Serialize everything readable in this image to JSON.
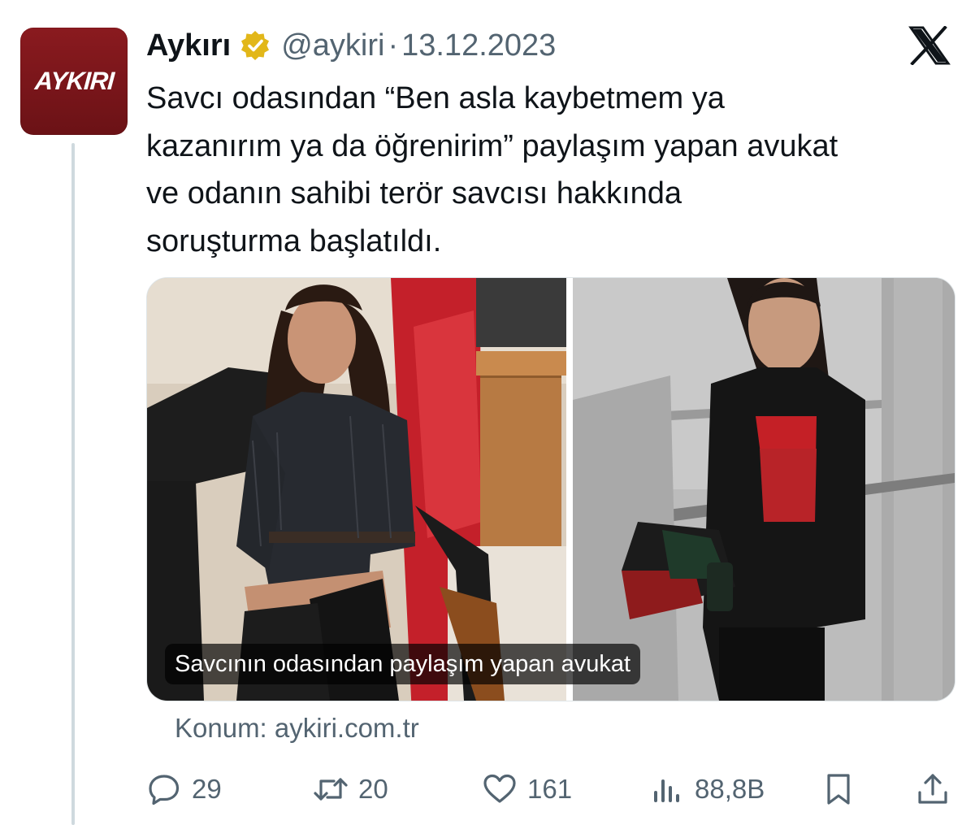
{
  "author": {
    "avatar_logo_text": "AYKIRI",
    "display_name": "Aykırı",
    "verified_icon": "gold-verified-badge-icon",
    "handle": "@aykiri",
    "separator": "·",
    "date": "13.12.2023"
  },
  "platform_icon": "x-logo-icon",
  "tweet": {
    "lines": [
      "Savcı odasından “Ben asla kaybetmem ya",
      "kazanırım ya da öğrenirim” paylaşım yapan avukat",
      "ve odanın sahibi terör savcısı hakkında",
      "soruşturma başlatıldı."
    ]
  },
  "media": {
    "left_photo": "photo-woman-seated-in-office-chair",
    "right_photo": "photo-woman-standing-in-courthouse",
    "caption": "Savcının odasından paylaşım yapan avukat"
  },
  "location": "Konum: aykiri.com.tr",
  "actions": {
    "reply": {
      "icon": "reply-icon",
      "count": "29"
    },
    "retweet": {
      "icon": "retweet-icon",
      "count": "20"
    },
    "like": {
      "icon": "heart-icon",
      "count": "161"
    },
    "views": {
      "icon": "views-icon",
      "count": "88,8B"
    },
    "bookmark": {
      "icon": "bookmark-icon"
    },
    "share": {
      "icon": "share-icon"
    }
  },
  "colors": {
    "text_primary": "#0f1419",
    "text_secondary": "#536471",
    "avatar_bg": "#7a161b",
    "verified_gold": "#e2b719",
    "thread_line": "#cfd9de"
  }
}
